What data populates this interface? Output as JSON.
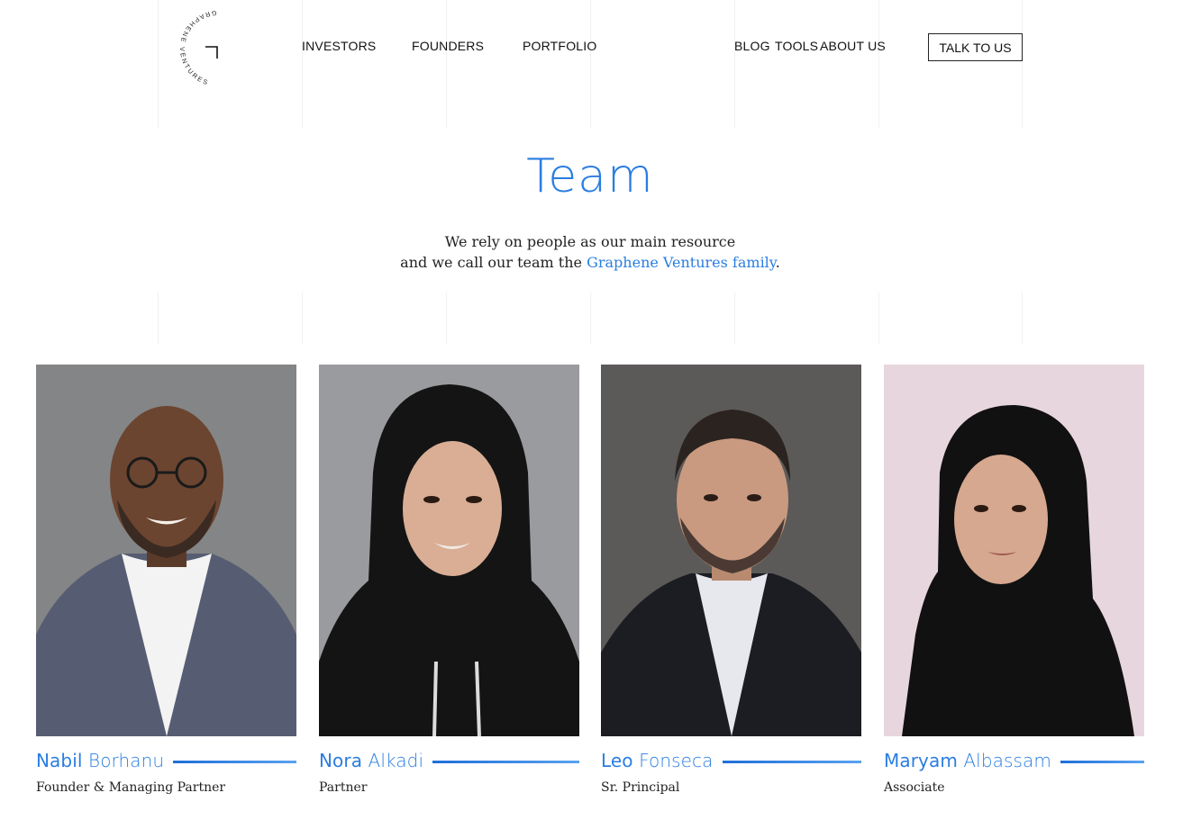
{
  "brand": {
    "logo_text": "GRAPHENE VENTURES"
  },
  "nav": {
    "left": [
      {
        "label": "INVESTORS"
      },
      {
        "label": "FOUNDERS"
      },
      {
        "label": "PORTFOLIO"
      }
    ],
    "right": [
      {
        "label": "BLOG"
      },
      {
        "label": "TOOLS"
      },
      {
        "label": "ABOUT US"
      }
    ],
    "cta_label": "TALK TO US"
  },
  "hero": {
    "title": "Team",
    "line1": "We rely on people as our main resource",
    "line2_prefix": "and we call our team the ",
    "line2_highlight": "Graphene Ventures family",
    "line2_suffix": "."
  },
  "team": [
    {
      "first": "Nabil",
      "last": "Borhanu",
      "role": "Founder & Managing Partner"
    },
    {
      "first": "Nora",
      "last": "Alkadi",
      "role": "Partner"
    },
    {
      "first": "Leo",
      "last": "Fonseca",
      "role": "Sr. Principal"
    },
    {
      "first": "Maryam",
      "last": "Albassam",
      "role": "Associate"
    }
  ],
  "colors": {
    "accent": "#2a7de1",
    "text": "#111111"
  }
}
